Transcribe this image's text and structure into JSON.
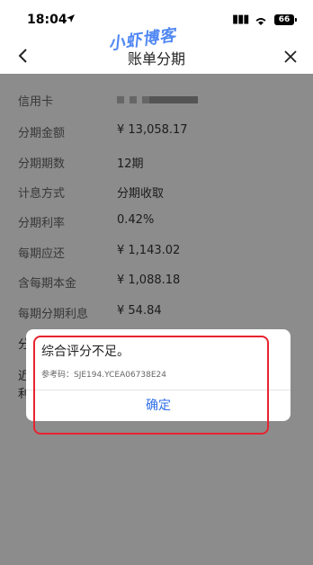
{
  "status": {
    "time": "18:04",
    "battery": "66"
  },
  "nav": {
    "title": "账单分期"
  },
  "watermark": "小虾博客",
  "rows": [
    {
      "label": "信用卡",
      "value": ""
    },
    {
      "label": "分期金额",
      "value": "¥ 13,058.17"
    },
    {
      "label": "分期期数",
      "value": "12期"
    },
    {
      "label": "计息方式",
      "value": "分期收取"
    },
    {
      "label": "分期利率",
      "value": "0.42%"
    },
    {
      "label": "每期应还",
      "value": "¥ 1,143.02"
    },
    {
      "label": "含每期本金",
      "value": "¥ 1,088.18"
    },
    {
      "label": "每期分期利息",
      "value": "¥ 54.84"
    }
  ],
  "partial": {
    "a": "分",
    "b": "近",
    "c": "利"
  },
  "dialog": {
    "title": "综合评分不足。",
    "reference": "参考码：SJE194.YCEA06738E24",
    "confirm": "确定"
  },
  "colors": {
    "accent": "#2f6fe8",
    "highlight": "#e8232f",
    "watermark": "#3e7bf2"
  }
}
